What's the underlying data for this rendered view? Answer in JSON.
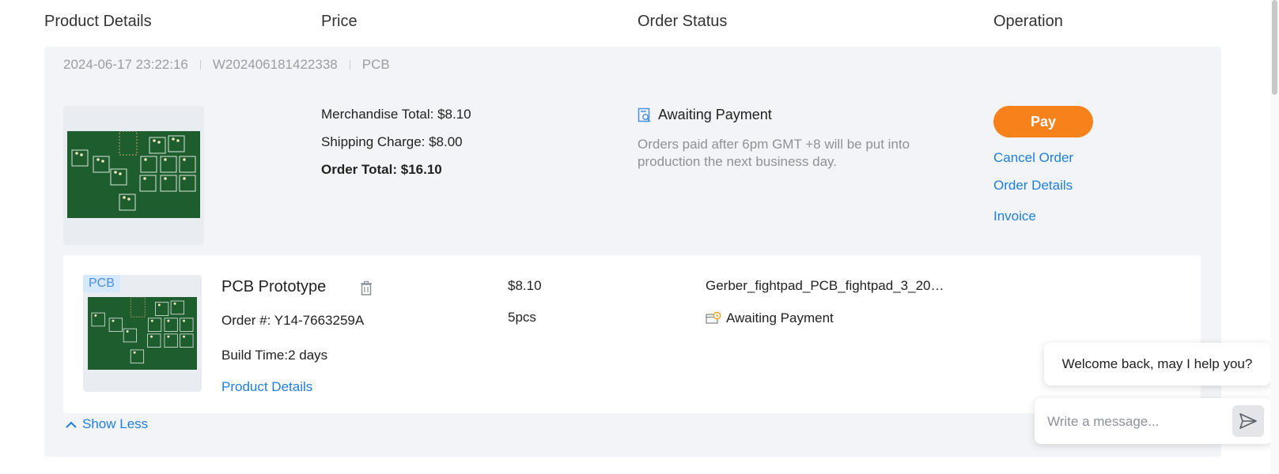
{
  "columns": {
    "product_details": "Product Details",
    "price": "Price",
    "order_status": "Order Status",
    "operation": "Operation"
  },
  "order": {
    "date": "2024-06-17 23:22:16",
    "order_id": "W202406181422338",
    "type": "PCB",
    "merchandise_total": "Merchandise Total: $8.10",
    "shipping_charge": "Shipping Charge: $8.00",
    "order_total": "Order Total: $16.10",
    "status": "Awaiting Payment",
    "status_note": "Orders paid after 6pm GMT +8 will be put into production the next business day.",
    "pay_label": "Pay",
    "cancel_label": "Cancel Order",
    "details_label": "Order Details",
    "invoice_label": "Invoice"
  },
  "item": {
    "tag": "PCB",
    "name": "PCB Prototype",
    "order_number": "Order #: Y14-7663259A",
    "build_time": "Build Time:2 days",
    "details_link": "Product Details",
    "price": "$8.10",
    "quantity": "5pcs",
    "file": "Gerber_fightpad_PCB_fightpad_3_20…",
    "status": "Awaiting Payment"
  },
  "show_less": "Show Less",
  "chat": {
    "welcome": "Welcome back, may I help you?",
    "placeholder": "Write a message..."
  },
  "colors": {
    "accent": "#1f7fe0",
    "pay": "#f7811b",
    "pcb_green": "#1e5d2e"
  },
  "icons": {
    "status": "awaiting-payment-doc-icon",
    "item_status": "wallet-clock-icon",
    "delete": "trash-icon",
    "collapse": "chevron-up-icon",
    "send": "send-icon"
  }
}
